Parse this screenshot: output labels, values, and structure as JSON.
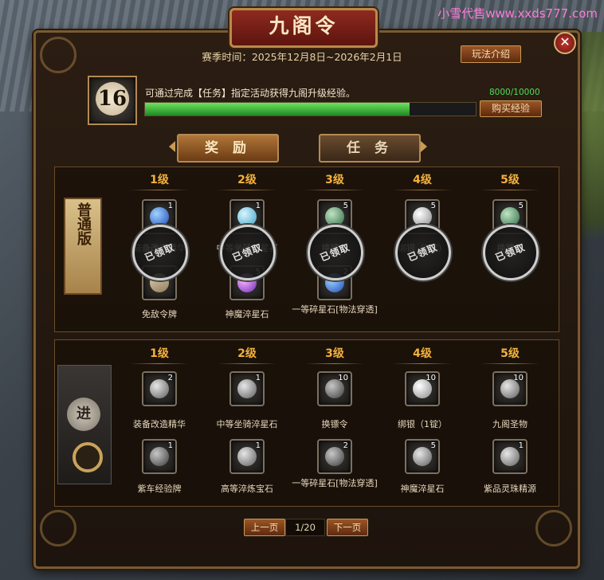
{
  "watermark": "小雪代售www.xxds777.com",
  "title": "九阁令",
  "season": "赛季时间：2025年12月8日~2026年2月1日",
  "rules_button": "玩法介绍",
  "level": "16",
  "description": "可通过完成【任务】指定活动获得九阁升级经验。",
  "exp": {
    "text": "8000/10000",
    "current": 8000,
    "max": 10000
  },
  "buy_button": "购买经验",
  "tabs": {
    "reward": "奖 励",
    "task": "任 务"
  },
  "tiers": [
    "1级",
    "2级",
    "3级",
    "4级",
    "5级"
  ],
  "normal": {
    "badge": "普通版",
    "stamp": "已领取",
    "items_top": [
      {
        "qty": "1",
        "name": "装备改造精华",
        "icon": "blue-gem-icon"
      },
      {
        "qty": "1",
        "name": "中等坐骑淬星石",
        "icon": "cyan-gem-icon"
      },
      {
        "qty": "5",
        "name": "换镖令",
        "icon": "jade-token-icon"
      },
      {
        "qty": "5",
        "name": "绑银（1锭）",
        "icon": "silver-ingot-icon"
      },
      {
        "qty": "5",
        "name": "换镖令",
        "icon": "jade-token-icon"
      }
    ],
    "items_bottom": [
      {
        "qty": "",
        "name": "免敌令牌",
        "icon": "token-icon"
      },
      {
        "qty": "5",
        "name": "神魔淬星石",
        "icon": "purple-gem-icon"
      },
      {
        "qty": "2",
        "name": "一等碎星石[物法穿透]",
        "icon": "blue-shard-icon"
      }
    ]
  },
  "advanced": {
    "badge": "进",
    "items_top": [
      {
        "qty": "2",
        "name": "装备改造精华"
      },
      {
        "qty": "1",
        "name": "中等坐骑淬星石"
      },
      {
        "qty": "10",
        "name": "换镖令"
      },
      {
        "qty": "10",
        "name": "绑银（1锭）"
      },
      {
        "qty": "10",
        "name": "九阁圣物"
      }
    ],
    "items_bottom": [
      {
        "qty": "1",
        "name": "紫车经验牌"
      },
      {
        "qty": "1",
        "name": "高等淬炼宝石"
      },
      {
        "qty": "2",
        "name": "一等碎星石[物法穿透]"
      },
      {
        "qty": "5",
        "name": "神魔淬星石"
      },
      {
        "qty": "1",
        "name": "紫品灵珠精源"
      }
    ]
  },
  "pager": {
    "prev": "上一页",
    "page": "1/20",
    "next": "下一页"
  },
  "colors": {
    "accent": "#f3b13c",
    "exp_text": "#4cde5a",
    "title_bg": "#8e2a1f"
  }
}
